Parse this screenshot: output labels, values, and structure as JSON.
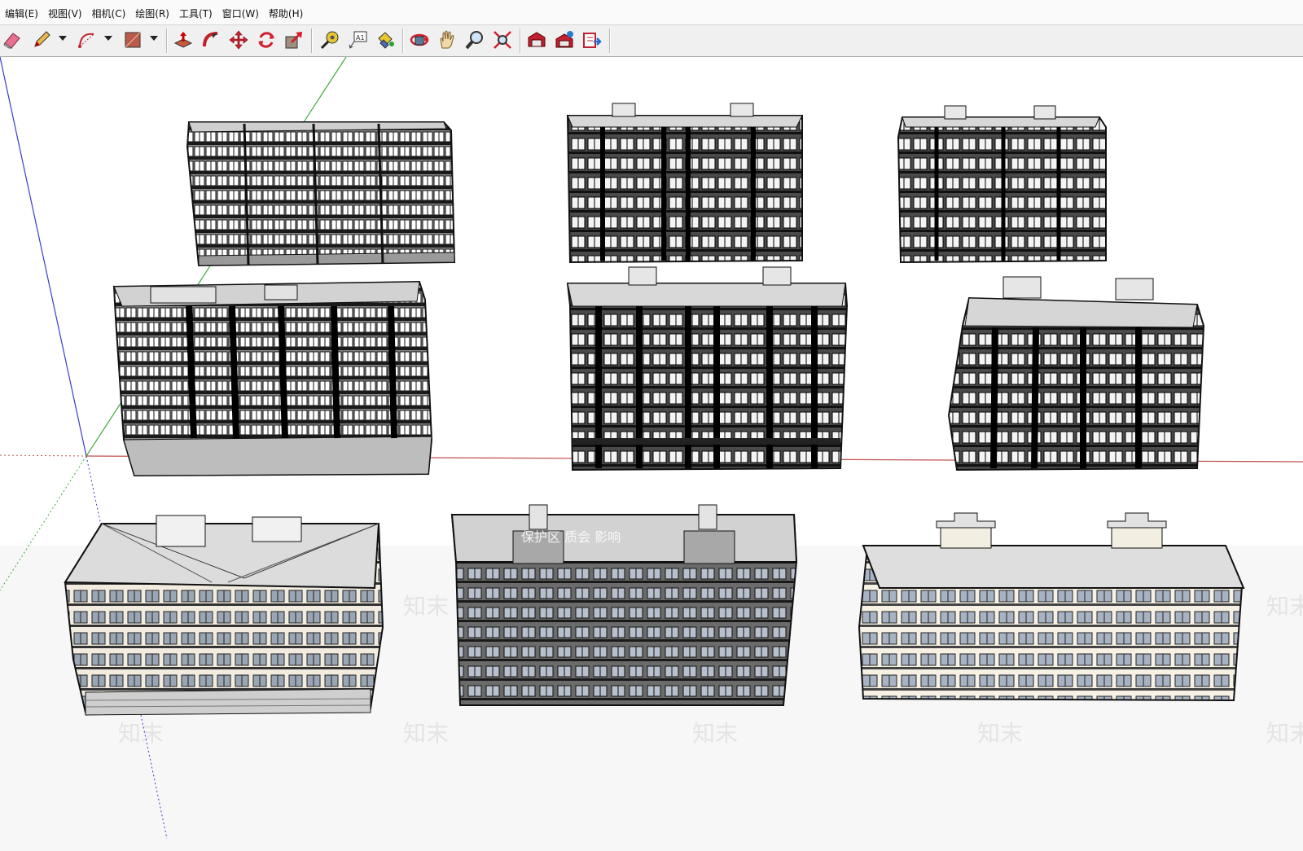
{
  "menubar": {
    "items": [
      "编辑(E)",
      "视图(V)",
      "相机(C)",
      "绘图(R)",
      "工具(T)",
      "窗口(W)",
      "帮助(H)"
    ]
  },
  "toolbar": {
    "tools": [
      {
        "name": "eraser-icon"
      },
      {
        "name": "pencil-icon"
      },
      {
        "name": "arc-icon"
      },
      {
        "name": "rectangle-icon"
      },
      {
        "name": "push-pull-icon"
      },
      {
        "name": "follow-me-icon"
      },
      {
        "name": "move-icon"
      },
      {
        "name": "rotate-icon"
      },
      {
        "name": "scale-icon"
      },
      {
        "name": "tape-measure-icon"
      },
      {
        "name": "text-icon"
      },
      {
        "name": "paint-bucket-icon"
      },
      {
        "name": "orbit-icon"
      },
      {
        "name": "pan-icon"
      },
      {
        "name": "zoom-icon"
      },
      {
        "name": "zoom-extents-icon"
      },
      {
        "name": "warehouse-icon"
      },
      {
        "name": "extension-warehouse-icon"
      },
      {
        "name": "send-to-layout-icon"
      }
    ]
  },
  "viewport": {
    "watermarks": [
      "知末",
      "知末",
      "知末",
      "知末",
      "知末",
      "知末",
      "知末"
    ],
    "overlay_text": "保护区 质会 影响",
    "axis_colors": {
      "red": "#c0504d",
      "green": "#3daa3d",
      "blue": "#3b3bd0"
    },
    "buildings": [
      {
        "id": "building-1"
      },
      {
        "id": "building-2"
      },
      {
        "id": "building-3"
      },
      {
        "id": "building-4"
      },
      {
        "id": "building-5"
      },
      {
        "id": "building-6"
      },
      {
        "id": "building-7"
      },
      {
        "id": "building-8"
      },
      {
        "id": "building-9"
      }
    ]
  }
}
